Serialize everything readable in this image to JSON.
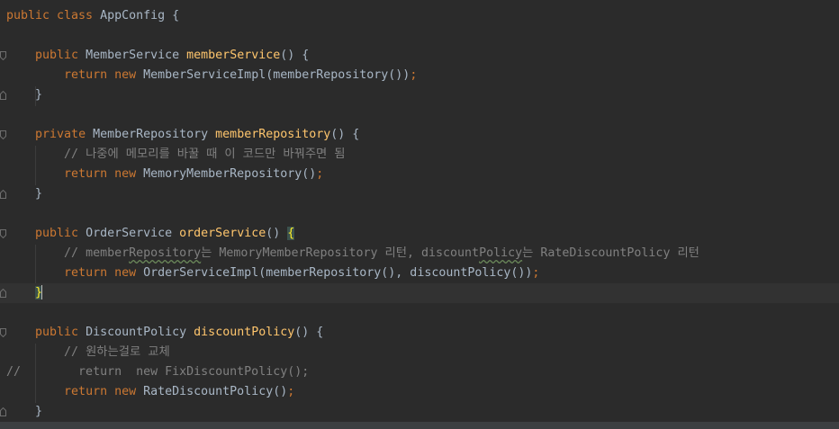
{
  "editor": {
    "lines": {
      "l1": {
        "kw": "public class ",
        "ty": "AppConfig {"
      },
      "l3": {
        "kw": "public ",
        "ty": "MemberService ",
        "fn": "memberService",
        "rest": "() {"
      },
      "l4": {
        "kw": "return new ",
        "ty": "MemberServiceImpl(memberRepository())",
        "semi": ";"
      },
      "l5": {
        "ty": "}"
      },
      "l7": {
        "kw": "private ",
        "ty": "MemberRepository ",
        "fn": "memberRepository",
        "rest": "() {"
      },
      "l8": {
        "cm": "// 나중에 메모리를 바꿀 때 이 코드만 바꿔주면 됨"
      },
      "l9": {
        "kw": "return new ",
        "ty": "MemoryMemberRepository()",
        "semi": ";"
      },
      "l10": {
        "ty": "}"
      },
      "l12": {
        "kw": "public ",
        "ty": "OrderService ",
        "fn": "orderService",
        "rest": "() ",
        "brace": "{"
      },
      "l13": {
        "cm_a": "// member",
        "cm_b": "Repository",
        "cm_c": "는 MemoryMemberRepository 리턴, discount",
        "cm_d": "Policy",
        "cm_e": "는 RateDiscountPolicy 리턴"
      },
      "l14": {
        "kw": "return new ",
        "ty": "OrderServiceImpl(memberRepository(), discountPolicy())",
        "semi": ";"
      },
      "l15": {
        "brace": "}"
      },
      "l17": {
        "kw": "public ",
        "ty": "DiscountPolicy ",
        "fn": "discountPolicy",
        "rest": "() {"
      },
      "l18": {
        "cm": "// 원하는걸로 교체"
      },
      "l19": {
        "cm": "//        return  new FixDiscountPolicy();"
      },
      "l20": {
        "kw": "return new ",
        "ty": "RateDiscountPolicy()",
        "semi": ";"
      },
      "l21": {
        "ty": "}"
      }
    }
  }
}
